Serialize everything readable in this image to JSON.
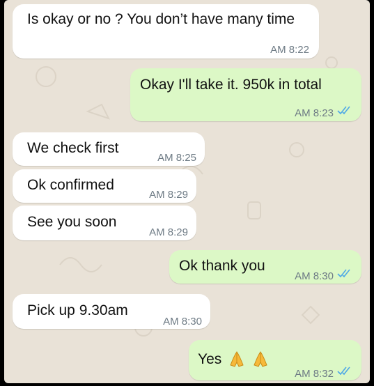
{
  "chat": {
    "ticks_color": "#4fa9e6",
    "messages": [
      {
        "dir": "in",
        "text": "Is okay or no ? You don’t have many time",
        "time": "AM 8:22"
      },
      {
        "dir": "out",
        "text": "Okay I'll take it. 950k in total",
        "time": "AM 8:23",
        "ticks": "double-check-icon"
      },
      {
        "dir": "in",
        "text": "We check first",
        "time": "AM 8:25"
      },
      {
        "dir": "in",
        "text": "Ok confirmed",
        "time": "AM 8:29"
      },
      {
        "dir": "in",
        "text": "See you soon",
        "time": "AM 8:29"
      },
      {
        "dir": "out",
        "text": "Ok thank you",
        "time": "AM 8:30",
        "ticks": "double-check-icon"
      },
      {
        "dir": "in",
        "text": "Pick up 9.30am",
        "time": "AM 8:30"
      },
      {
        "dir": "out",
        "text": "Yes",
        "emoji": [
          "folded-hands-emoji",
          "folded-hands-emoji"
        ],
        "time": "AM 8:32",
        "ticks": "double-check-icon"
      }
    ]
  }
}
